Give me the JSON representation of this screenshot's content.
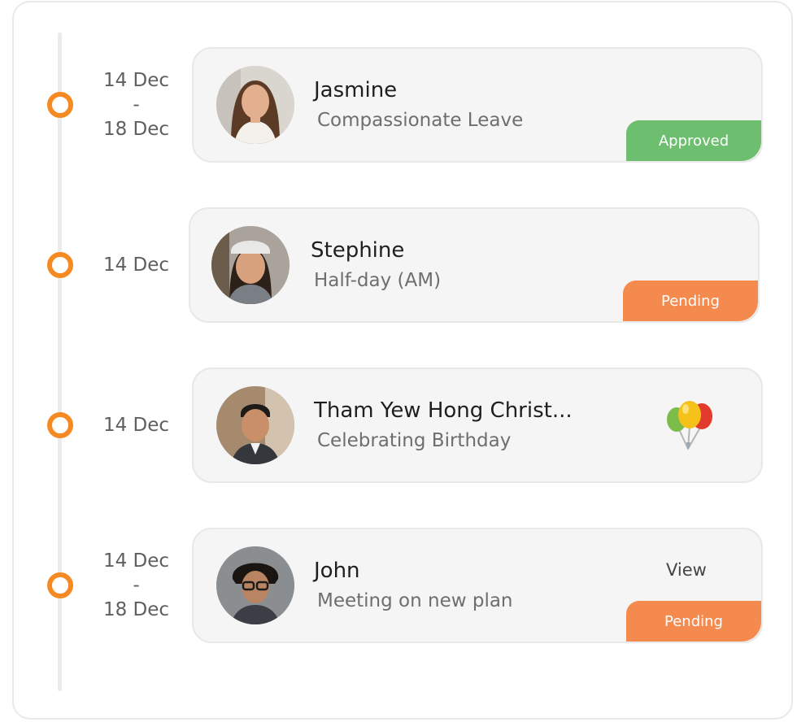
{
  "colors": {
    "accent": "#f58a23",
    "approved": "#6dbf6f",
    "pending": "#f58a4e"
  },
  "entries": [
    {
      "dates": [
        "14 Dec",
        "-",
        "18 Dec"
      ],
      "name": "Jasmine",
      "subtitle": "Compassionate Leave",
      "status": "Approved"
    },
    {
      "dates": [
        "14 Dec"
      ],
      "name": "Stephine",
      "subtitle": "Half-day (AM)",
      "status": "Pending"
    },
    {
      "dates": [
        "14 Dec"
      ],
      "name": "Tham Yew Hong Christ...",
      "subtitle": "Celebrating Birthday",
      "icon": "balloons-icon"
    },
    {
      "dates": [
        "14 Dec",
        "-",
        "18 Dec"
      ],
      "name": "John",
      "subtitle": "Meeting on new plan",
      "action": "View",
      "status": "Pending"
    }
  ]
}
